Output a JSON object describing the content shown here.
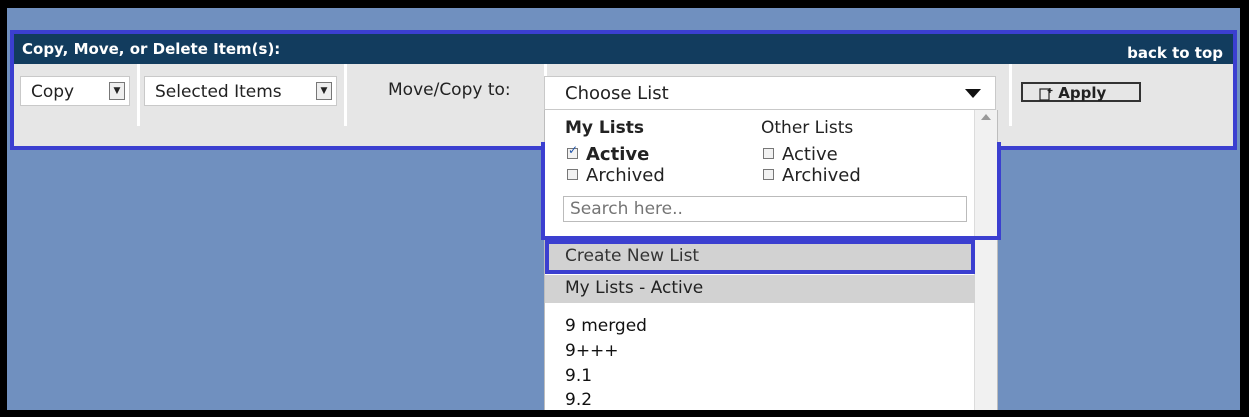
{
  "panel": {
    "title": "Copy, Move, or Delete Item(s):",
    "back_to_top": "back to top"
  },
  "controls": {
    "action_select": "Copy",
    "scope_select": "Selected Items",
    "move_copy_label": "Move/Copy to:",
    "destination_select": "Choose List",
    "apply_label": "Apply"
  },
  "dropdown": {
    "my_lists_heading": "My Lists",
    "other_lists_heading": "Other Lists",
    "my_lists_options": [
      {
        "label": "Active",
        "checked": true
      },
      {
        "label": "Archived",
        "checked": false
      }
    ],
    "other_lists_options": [
      {
        "label": "Active",
        "checked": false
      },
      {
        "label": "Archived",
        "checked": false
      }
    ],
    "search_placeholder": "Search here..",
    "create_new_list": "Create New List",
    "group_heading": "My Lists - Active",
    "items": [
      "9 merged",
      "9+++",
      "9.1",
      "9.2"
    ]
  },
  "colors": {
    "background": "#7090bf",
    "header": "#123c5e",
    "highlight_border": "#3b3fd0",
    "panel": "#e6e6e6"
  }
}
